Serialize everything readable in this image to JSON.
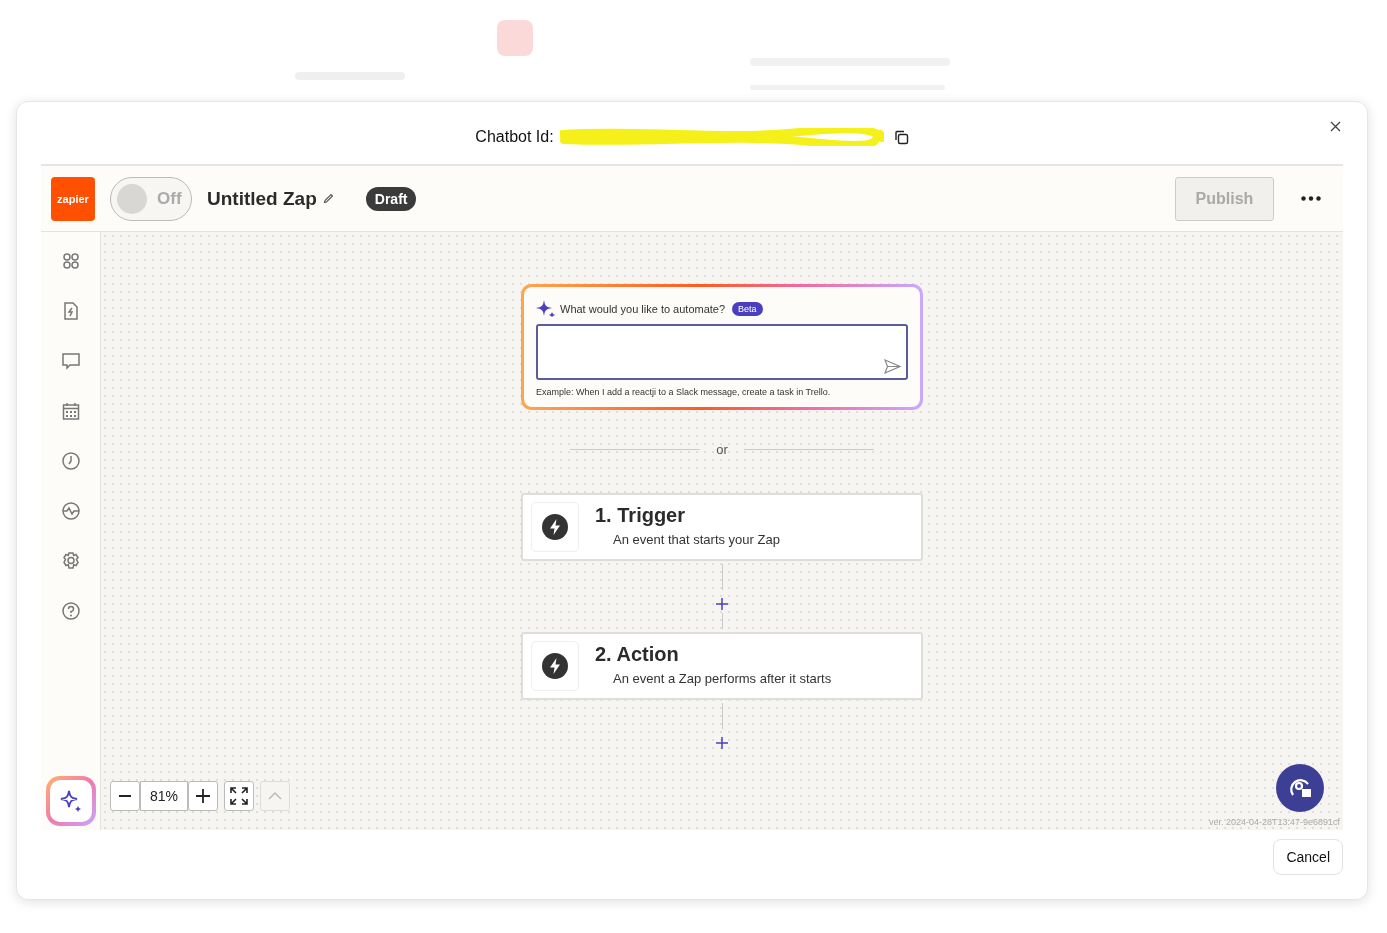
{
  "header": {
    "label": "Chatbot Id:"
  },
  "toolbar": {
    "logo": "zapier",
    "toggle": {
      "label": "Off",
      "on": false
    },
    "title": "Untitled Zap",
    "status": "Draft",
    "publish": {
      "label": "Publish",
      "disabled": true
    }
  },
  "prompt": {
    "question": "What would you like to automate?",
    "badge": "Beta",
    "example": "Example: When I add a reactji to a Slack message, create a task in Trello."
  },
  "divider": "or",
  "steps": [
    {
      "title": "1. Trigger",
      "subtitle": "An event that starts your Zap"
    },
    {
      "title": "2. Action",
      "subtitle": "An event a Zap performs after it starts"
    }
  ],
  "zoom": {
    "value": "81%"
  },
  "version": "ver. 2024-04-28T13:47-9e6891cf",
  "footer": {
    "cancel": "Cancel"
  }
}
